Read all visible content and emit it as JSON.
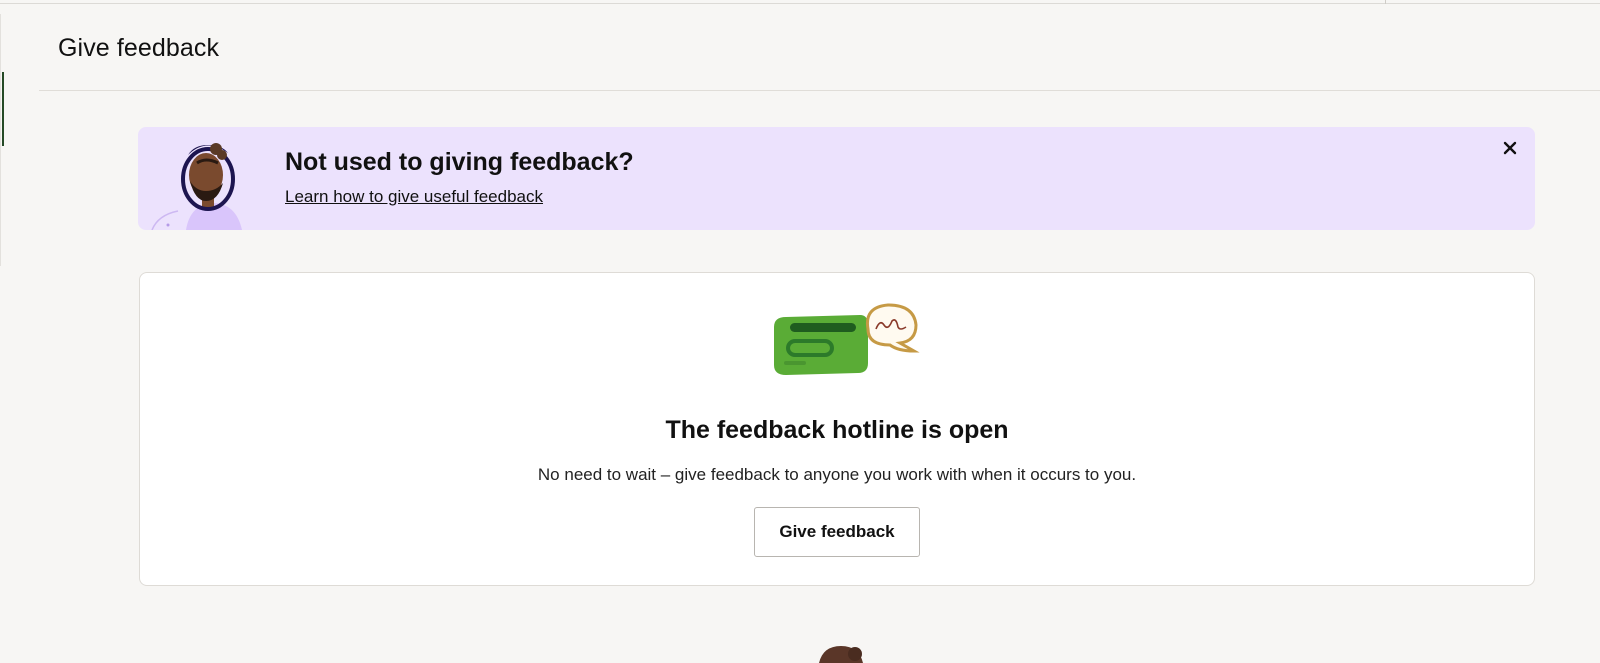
{
  "header": {
    "title": "Give feedback"
  },
  "banner": {
    "title": "Not used to giving feedback?",
    "link_text": "Learn how to give useful feedback",
    "close_icon": "close-icon"
  },
  "card": {
    "title": "The feedback hotline is open",
    "description": "No need to wait – give feedback to anyone you work with when it occurs to you.",
    "button_label": "Give feedback",
    "illustration_icon": "chat-bubbles-icon"
  },
  "colors": {
    "page_bg": "#f7f6f4",
    "banner_bg": "#ece2fd",
    "accent_green": "#5aac36",
    "active_rail": "#254a26"
  }
}
